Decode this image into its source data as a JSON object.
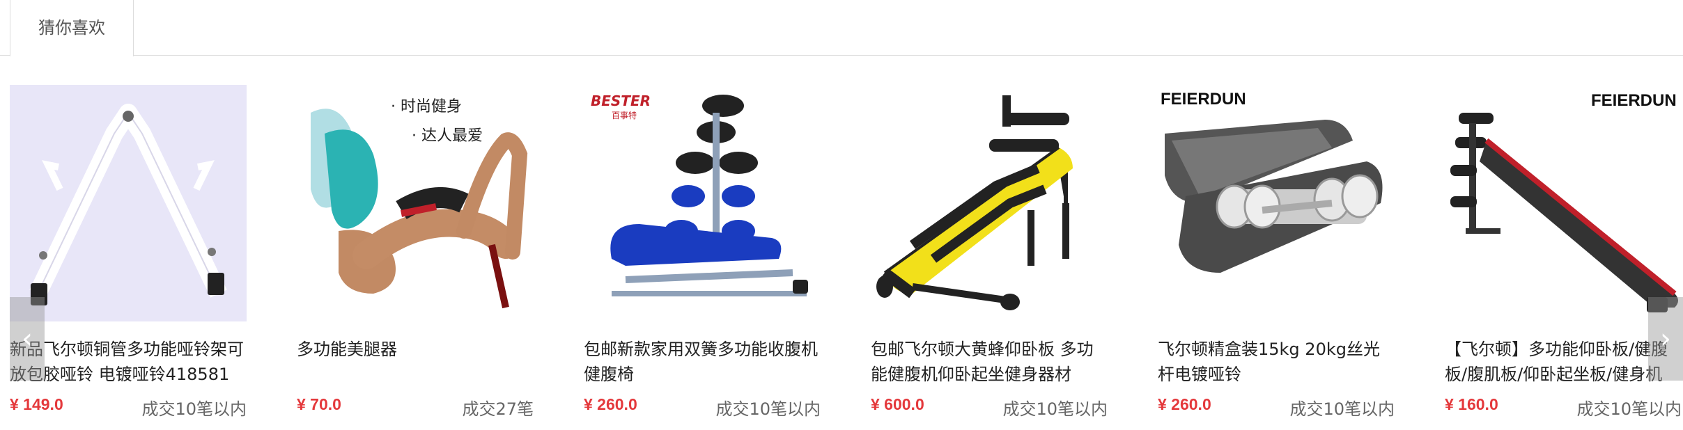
{
  "tabs": {
    "guess_you_like": "猜你喜欢"
  },
  "nav": {
    "prev_glyph": "‹",
    "next_glyph": "›"
  },
  "brands": {
    "bester": "BESTER",
    "bester_cn": "百事特",
    "feierdun": "FEIERDUN"
  },
  "ad_text": {
    "line1": "· 时尚健身",
    "line2": "· 达人最爱"
  },
  "products": [
    {
      "title": "新品飞尔顿铜管多功能哑铃架可放包胶哑铃 电镀哑铃418581",
      "price": "¥ 149.0",
      "sales": "成交10笔以内"
    },
    {
      "title": "多功能美腿器",
      "price": "¥ 70.0",
      "sales": "成交27笔"
    },
    {
      "title": "包邮新款家用双簧多功能收腹机健腹椅",
      "price": "¥ 260.0",
      "sales": "成交10笔以内"
    },
    {
      "title": "包邮飞尔顿大黄蜂仰卧板 多功能健腹机仰卧起坐健身器材",
      "price": "¥ 600.0",
      "sales": "成交10笔以内"
    },
    {
      "title": "飞尔顿精盒装15kg 20kg丝光杆电镀哑铃",
      "price": "¥ 260.0",
      "sales": "成交10笔以内"
    },
    {
      "title": "【飞尔顿】多功能仰卧板/健腹板/腹肌板/仰卧起坐板/健身机",
      "price": "¥ 160.0",
      "sales": "成交10笔以内"
    }
  ]
}
